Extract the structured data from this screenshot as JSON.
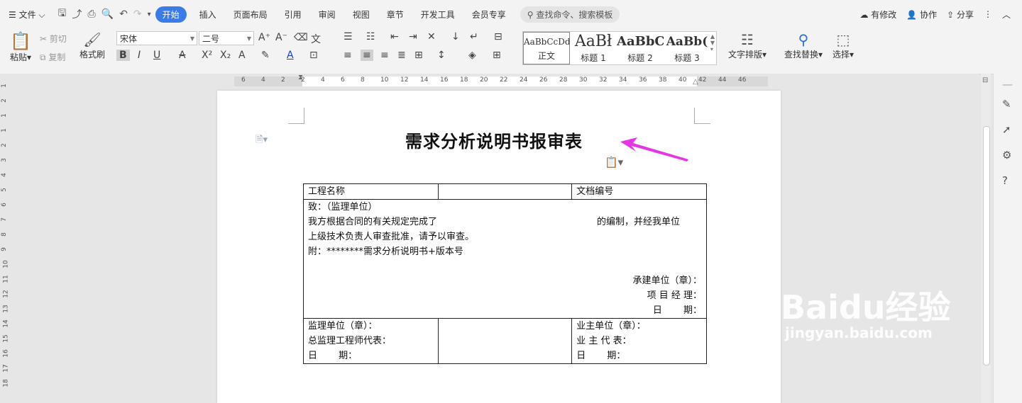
{
  "menubar": {
    "file_label": "文件",
    "tabs": [
      "开始",
      "插入",
      "页面布局",
      "引用",
      "审阅",
      "视图",
      "章节",
      "开发工具",
      "会员专享"
    ],
    "search_placeholder": "查找命令、搜索模板",
    "actions": {
      "changes": "有修改",
      "collab": "协作",
      "share": "分享"
    }
  },
  "ribbon": {
    "paste": "粘贴",
    "cut": "剪切",
    "copy": "复制",
    "format_painter": "格式刷",
    "font_name": "宋体",
    "font_size": "二号",
    "styles": [
      {
        "sample": "AaBbCcDd",
        "label": "正文"
      },
      {
        "sample": "AaBł",
        "label": "标题 1"
      },
      {
        "sample": "AaBbC",
        "label": "标题 2"
      },
      {
        "sample": "AaBb(",
        "label": "标题 3"
      }
    ],
    "text_layout": "文字排版",
    "find_replace": "查找替换",
    "select": "选择"
  },
  "ruler": {
    "h_ticks": [
      "6",
      "4",
      "2",
      "2",
      "4",
      "6",
      "8",
      "10",
      "12",
      "14",
      "16",
      "18",
      "20",
      "22",
      "24",
      "26",
      "28",
      "30",
      "32",
      "34",
      "36",
      "38",
      "40",
      "42",
      "44",
      "46"
    ],
    "v_ticks": [
      "1",
      "2",
      "1",
      "1",
      "2",
      "3",
      "4",
      "5",
      "6",
      "7",
      "8",
      "9",
      "10",
      "11",
      "12",
      "13",
      "14",
      "15",
      "16",
      "17",
      "18"
    ]
  },
  "document": {
    "title": "需求分析说明书报审表",
    "table": {
      "project_name": "工程名称",
      "doc_number": "文档编号",
      "to_line": "致：（监理单位）",
      "body1_left": "我方根据合同的有关规定完成了",
      "body1_right": "的编制，并经我单位",
      "body2": "上级技术负责人审查批准，请予以审查。",
      "attach": "附：********需求分析说明书+版本号",
      "contractor": "承建单位（章）：",
      "pm": "项 目 经 理：",
      "date1": "日　　 期：",
      "supervisor_unit": "监理单位（章）：",
      "chief_engineer": "总监理工程师代表：",
      "date2": "日　　 期：",
      "owner_unit": "业主单位（章）：",
      "owner_rep": "业 主 代 表：",
      "date3": "日　　 期："
    }
  },
  "watermark": {
    "brand": "Baidu经验",
    "url": "jingyan.baidu.com"
  }
}
